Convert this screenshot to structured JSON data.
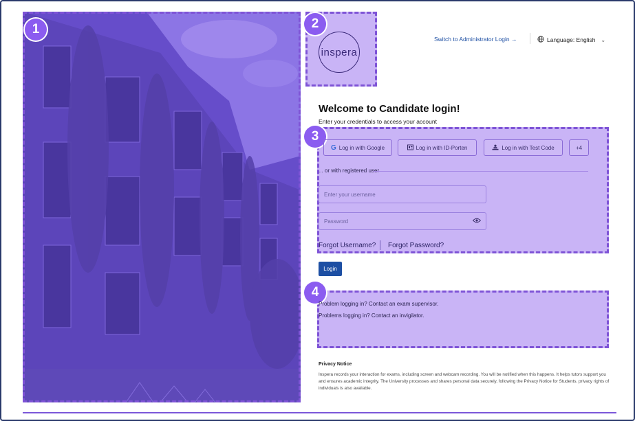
{
  "admin_link": "Switch to Administrator Login →",
  "language": "Language: English",
  "logo_text": "inspera",
  "welcome_title": "Welcome to Candidate login!",
  "welcome_subtitle": "Enter your credentials to access your account",
  "sso": {
    "google": "Log in with Google",
    "idporten": "Log in with ID-Porten",
    "testcode": "Log in with Test Code",
    "more": "+4"
  },
  "divider_text": "... or with registered user",
  "username_placeholder": "Enter your username",
  "password_placeholder": "Password",
  "forgot_username": "Forgot Username?",
  "forgot_password": "Forgot Password?",
  "login_button": "Login",
  "help": {
    "line1": "Problem logging in? Contact an exam supervisor.",
    "line2": "Problems logging in? Contact an invigilator."
  },
  "privacy": {
    "title": "Privacy Notice",
    "text": "Inspera records your interaction for exams, including screen and webcam recording. You will be notified when this happens. It helps tutors support you and ensures academic integrity. The University processes and shares personal data securely, following the Privacy Notice for Students.  privacy rights of individuals is also available."
  },
  "badges": [
    "1",
    "2",
    "3",
    "4"
  ],
  "colors": {
    "accent": "#8b5cf0",
    "link": "#1d4fa3",
    "zone_fill": "#9c76ee"
  }
}
